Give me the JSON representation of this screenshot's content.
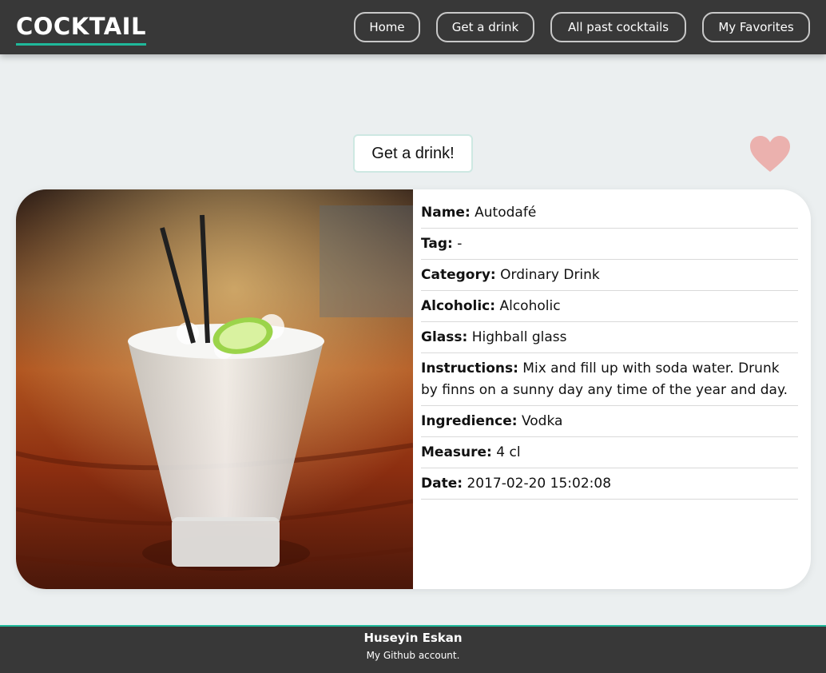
{
  "header": {
    "logo": "COCKTAIL",
    "nav": [
      {
        "label": "Home"
      },
      {
        "label": "Get a drink"
      },
      {
        "label": "All past cocktails"
      },
      {
        "label": "My Favorites"
      }
    ]
  },
  "main": {
    "get_button": "Get a drink!",
    "favorite_icon": "heart-icon",
    "details": [
      {
        "label": "Name:",
        "value": "Autodafé"
      },
      {
        "label": "Tag:",
        "value": "-"
      },
      {
        "label": "Category:",
        "value": "Ordinary Drink"
      },
      {
        "label": "Alcoholic:",
        "value": "Alcoholic"
      },
      {
        "label": "Glass:",
        "value": "Highball glass"
      },
      {
        "label": "Instructions:",
        "value": "Mix and fill up with soda water. Drunk by finns on a sunny day any time of the year and day."
      },
      {
        "label": "Ingredience:",
        "value": "Vodka"
      },
      {
        "label": "Measure:",
        "value": "4 cl"
      },
      {
        "label": "Date:",
        "value": "2017-02-20 15:02:08"
      }
    ]
  },
  "footer": {
    "author": "Huseyin Eskan",
    "link": "My Github account."
  },
  "colors": {
    "nav_bg": "#383838",
    "accent": "#1fb89a",
    "page_bg": "#ebeff0",
    "heart": "#ebb1ae"
  }
}
